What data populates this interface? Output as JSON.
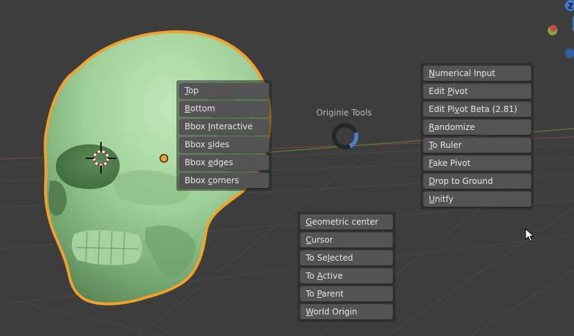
{
  "pie_menu": {
    "title": "Originie Tools",
    "left_items": [
      {
        "pre": "",
        "key": "T",
        "post": "op"
      },
      {
        "pre": "",
        "key": "B",
        "post": "ottom"
      },
      {
        "pre": "Bbox ",
        "key": "I",
        "post": "nteractive"
      },
      {
        "pre": "Bbox ",
        "key": "s",
        "post": "ides"
      },
      {
        "pre": "Bbox ",
        "key": "e",
        "post": "dges"
      },
      {
        "pre": "Bbox ",
        "key": "c",
        "post": "orners"
      }
    ],
    "right_items": [
      {
        "pre": "",
        "key": "N",
        "post": "umerical Input"
      },
      {
        "pre": "Edit ",
        "key": "P",
        "post": "ivot"
      },
      {
        "pre": "Edit Pi",
        "key": "v",
        "post": "ot Beta (2.81)"
      },
      {
        "pre": "",
        "key": "R",
        "post": "andomize"
      },
      {
        "pre": "",
        "key": "T",
        "post": "o Ruler"
      },
      {
        "pre": "",
        "key": "F",
        "post": "ake Pivot"
      },
      {
        "pre": "",
        "key": "D",
        "post": "rop to Ground"
      },
      {
        "pre": "",
        "key": "U",
        "post": "nitfy"
      }
    ],
    "bottom_items": [
      {
        "pre": "",
        "key": "G",
        "post": "eometric center"
      },
      {
        "pre": "",
        "key": "C",
        "post": "ursor"
      },
      {
        "pre": "To Se",
        "key": "l",
        "post": "ected"
      },
      {
        "pre": "To ",
        "key": "A",
        "post": "ctive"
      },
      {
        "pre": "To ",
        "key": "P",
        "post": "arent"
      },
      {
        "pre": "",
        "key": "W",
        "post": "orld Origin"
      }
    ]
  },
  "gizmo": {
    "z_label": "Z"
  },
  "colors": {
    "background": "#3d3d3d",
    "button": "#545454",
    "button_text": "#e6e6e6",
    "selection_outline": "#f5a028",
    "skull_base": "#9fcf99",
    "axis_x": "#c84a4a",
    "axis_y": "#86a83a",
    "axis_z": "#3d7dd8"
  },
  "icons": {
    "cursor": "3d-cursor-icon",
    "origin": "object-origin-icon",
    "mouse": "mouse-pointer-icon"
  }
}
